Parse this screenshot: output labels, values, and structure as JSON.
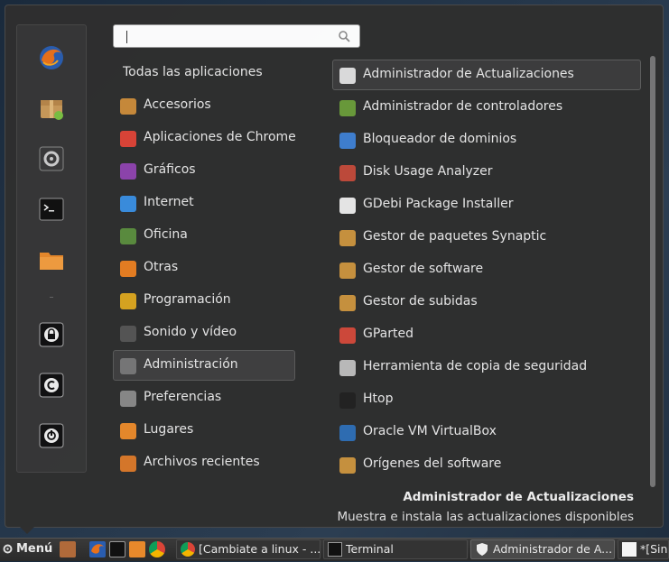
{
  "search": {
    "value": "",
    "placeholder": ""
  },
  "favorites": [
    {
      "name": "firefox"
    },
    {
      "name": "software-manager"
    },
    {
      "name": "system-settings"
    },
    {
      "name": "terminal"
    },
    {
      "name": "files"
    },
    {
      "name": "lock-screen"
    },
    {
      "name": "logout"
    },
    {
      "name": "power"
    }
  ],
  "categories": {
    "all_label": "Todas las aplicaciones",
    "items": [
      {
        "label": "Accesorios",
        "color": "#c98a3a"
      },
      {
        "label": "Aplicaciones de Chrome",
        "color": "#db4437"
      },
      {
        "label": "Gráficos",
        "color": "#8e44ad"
      },
      {
        "label": "Internet",
        "color": "#3a8dde"
      },
      {
        "label": "Oficina",
        "color": "#5b8c3e"
      },
      {
        "label": "Otras",
        "color": "#e67e22"
      },
      {
        "label": "Programación",
        "color": "#d9a520"
      },
      {
        "label": "Sonido y vídeo",
        "color": "#555555"
      },
      {
        "label": "Administración",
        "color": "#777777",
        "selected": true
      },
      {
        "label": "Preferencias",
        "color": "#888888"
      },
      {
        "label": "Lugares",
        "color": "#e8892b"
      },
      {
        "label": "Archivos recientes",
        "color": "#d8782a"
      }
    ]
  },
  "apps": [
    {
      "label": "Administrador de Actualizaciones",
      "color": "#dddddd",
      "selected": true
    },
    {
      "label": "Administrador de controladores",
      "color": "#6a9a3a"
    },
    {
      "label": "Bloqueador de dominios",
      "color": "#3f7fd0"
    },
    {
      "label": "Disk Usage Analyzer",
      "color": "#c04a3a"
    },
    {
      "label": "GDebi Package Installer",
      "color": "#e8e8e8"
    },
    {
      "label": "Gestor de paquetes Synaptic",
      "color": "#c9923e"
    },
    {
      "label": "Gestor de software",
      "color": "#c9923e"
    },
    {
      "label": "Gestor de subidas",
      "color": "#c9923e"
    },
    {
      "label": "GParted",
      "color": "#d0493a"
    },
    {
      "label": "Herramienta de copia de seguridad",
      "color": "#bbbbbb"
    },
    {
      "label": "Htop",
      "color": "#222222"
    },
    {
      "label": "Oracle VM VirtualBox",
      "color": "#2f6db3"
    },
    {
      "label": "Orígenes del software",
      "color": "#c9923e"
    }
  ],
  "description": {
    "title": "Administrador de Actualizaciones",
    "text": "Muestra e instala las actualizaciones disponibles"
  },
  "taskbar": {
    "menu_label": "Menú",
    "windows": [
      {
        "label": "[Cambiate a linux - ..."
      },
      {
        "label": "Terminal"
      },
      {
        "label": "Administrador de A..."
      },
      {
        "label": "*[Sin t"
      }
    ]
  }
}
